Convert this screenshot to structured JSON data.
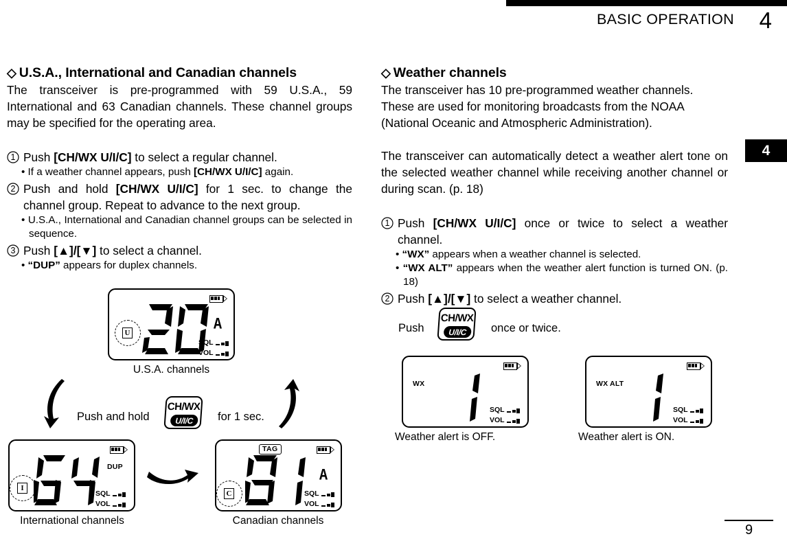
{
  "header": {
    "title": "BASIC OPERATION",
    "chapter": "4"
  },
  "chapter_tab": "4",
  "page_number": "9",
  "left_column": {
    "heading_diamond": "◇",
    "heading": "U.S.A., International and Canadian channels",
    "intro": "The transceiver is pre-programmed with 59 U.S.A., 59 International and 63 Canadian channels. These channel groups may be specified for the operating area.",
    "steps": [
      {
        "num": "1",
        "text_a": "Push ",
        "key": "[CH/WX U/I/C]",
        "text_b": " to select a regular channel.",
        "bullets": [
          {
            "a": "• If a weather channel appears, push ",
            "key": "[CH/WX U/I/C]",
            "b": " again."
          }
        ]
      },
      {
        "num": "2",
        "text_a": "Push and hold ",
        "key": "[CH/WX U/I/C]",
        "text_b": " for 1 sec. to change the channel group. Repeat to advance to the next group.",
        "bullets": [
          {
            "a": "• U.S.A., International and Canadian channel groups can be selected in sequence.",
            "key": "",
            "b": ""
          }
        ]
      },
      {
        "num": "3",
        "text_a": "Push ",
        "key": "[▲]/[▼]",
        "text_b": " to select a channel.",
        "bullets": [
          {
            "a": "• ",
            "key": "“DUP”",
            "b": " appears for duplex channels."
          }
        ]
      }
    ],
    "figure": {
      "usa": {
        "caption": "U.S.A. channels",
        "channel": "20",
        "suffix": "A",
        "group": "U",
        "sql_label": "SQL",
        "vol_label": "VOL",
        "battery": "battery-icon"
      },
      "intl": {
        "caption": "International channels",
        "channel": "64",
        "suffix": "",
        "group": "I",
        "dup": "DUP",
        "sql_label": "SQL",
        "vol_label": "VOL"
      },
      "canada": {
        "caption": "Canadian channels",
        "channel": "81",
        "suffix": "A",
        "group": "C",
        "tag": "TAG",
        "sql_label": "SQL",
        "vol_label": "VOL"
      },
      "key_text_before": "Push and hold",
      "key_line1": "CH/WX",
      "key_line2": "U/I/C",
      "key_text_after": "for 1 sec."
    }
  },
  "right_column": {
    "heading_diamond": "◇",
    "heading": "Weather channels",
    "intro1": "The transceiver has 10 pre-programmed weather channels. These are used for monitoring broadcasts from the NOAA (National Oceanic and Atmospheric Administration).",
    "intro2_a": "The transceiver can automatically detect a weather alert tone on the selected weather channel while receiving another channel or during scan. ",
    "intro2_b": "(p. 18)",
    "steps": [
      {
        "num": "1",
        "text_a": "Push ",
        "key": "[CH/WX U/I/C]",
        "text_b": " once or twice to select a weather channel.",
        "bullets": [
          {
            "a": "• ",
            "key": "“WX”",
            "b": " appears when a weather channel is selected."
          },
          {
            "a": "• ",
            "key": "“WX ALT”",
            "b": " appears when the weather alert function is turned ON. (p. 18)"
          }
        ]
      },
      {
        "num": "2",
        "text_a": "Push ",
        "key": "[▲]/[▼]",
        "text_b": " to select a weather channel.",
        "bullets": []
      }
    ],
    "figure": {
      "push_label": "Push",
      "key_line1": "CH/WX",
      "key_line2": "U/I/C",
      "after_label": "once or twice.",
      "wx_off": {
        "indicator": "WX",
        "channel": "1",
        "caption": "Weather alert is OFF.",
        "sql_label": "SQL",
        "vol_label": "VOL"
      },
      "wx_on": {
        "indicator": "WX ALT",
        "channel": "1",
        "caption": "Weather alert is ON.",
        "sql_label": "SQL",
        "vol_label": "VOL"
      }
    }
  },
  "colors": {
    "ink": "#000000",
    "paper": "#ffffff"
  }
}
